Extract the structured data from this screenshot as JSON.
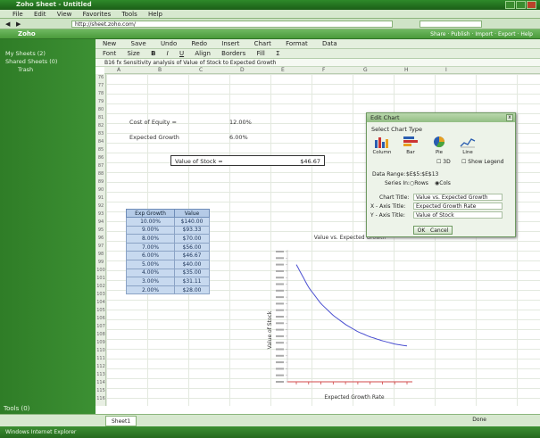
{
  "window": {
    "title": "Zoho Sheet - Untitled"
  },
  "menu": [
    "File",
    "Edit",
    "View",
    "Favorites",
    "Tools",
    "Help"
  ],
  "address": {
    "url": "http://sheet.zoho.com/"
  },
  "favbar": {
    "left": "Zoho",
    "right": "Share · Publish · Import · Export · Help"
  },
  "left_panel": {
    "items": [
      "My Sheets (2)",
      "Shared Sheets (0)",
      "Trash"
    ],
    "bottom": "Tools (0)"
  },
  "toolbar1": [
    "New",
    "Save",
    "Undo",
    "Redo",
    "Insert",
    "Chart",
    "Format",
    "Data"
  ],
  "toolbar2": [
    "Font",
    "Size",
    "B",
    "I",
    "U",
    "Align",
    "Borders",
    "Fill",
    "Σ"
  ],
  "formula_bar": "B16   fx  Sensitivity analysis of Value of Stock to Expected Growth",
  "columns": [
    "A",
    "B",
    "C",
    "D",
    "E",
    "F",
    "G",
    "H",
    "I"
  ],
  "rows": [
    "76",
    "77",
    "78",
    "79",
    "80",
    "81",
    "82",
    "83",
    "84",
    "85",
    "86",
    "87",
    "88",
    "89",
    "90",
    "91",
    "92",
    "93",
    "94",
    "95",
    "96",
    "97",
    "98",
    "99",
    "100",
    "101",
    "102",
    "103",
    "104",
    "105",
    "106",
    "107",
    "108",
    "109",
    "110",
    "111",
    "112",
    "113",
    "114",
    "115",
    "116"
  ],
  "inputs": [
    {
      "label": "Cost of Equity =",
      "value": "12.00%"
    },
    {
      "label": "Expected Growth",
      "value": "6.00%"
    }
  ],
  "result": {
    "label": "Value of Stock =",
    "value": "$46.67"
  },
  "sens_table": {
    "headers": [
      "Exp Growth",
      "Value"
    ],
    "rows": [
      [
        "10.00%",
        "$140.00"
      ],
      [
        "9.00%",
        "$93.33"
      ],
      [
        "8.00%",
        "$70.00"
      ],
      [
        "7.00%",
        "$56.00"
      ],
      [
        "6.00%",
        "$46.67"
      ],
      [
        "5.00%",
        "$40.00"
      ],
      [
        "4.00%",
        "$35.00"
      ],
      [
        "3.00%",
        "$31.11"
      ],
      [
        "2.00%",
        "$28.00"
      ]
    ]
  },
  "chart_data": {
    "type": "line",
    "title": "Value vs. Expected Growth",
    "xlabel": "Expected Growth Rate",
    "ylabel": "Value of Stock",
    "x": [
      1,
      2,
      3,
      4,
      5,
      6,
      7,
      8,
      9,
      10
    ],
    "series": [
      {
        "values": [
          1.8,
          1.45,
          1.2,
          1.02,
          0.88,
          0.77,
          0.69,
          0.63,
          0.58,
          0.55
        ]
      }
    ],
    "ylim": [
      0,
      2.0
    ],
    "color": "#4a4fd0",
    "axis_color": "#d04848"
  },
  "dialog": {
    "title": "Edit Chart",
    "close": "x",
    "select_type": "Select Chart Type",
    "chart_types": [
      "Column",
      "Bar",
      "Pie",
      "Line"
    ],
    "option_3d": "3D",
    "option_legend": "Show Legend",
    "data_range_label": "Data Range:",
    "data_range_value": "$E$5:$E$13",
    "series_in_label": "Series In:",
    "series_rows": "Rows",
    "series_cols": "Cols",
    "chart_title_label": "Chart Title:",
    "chart_title_value": "Value vs. Expected Growth",
    "xaxis_label": "X - Axis Title:",
    "xaxis_value": "Expected Growth Rate",
    "yaxis_label": "Y - Axis Title:",
    "yaxis_value": "Value of Stock",
    "ok": "OK",
    "cancel": "Cancel"
  },
  "status": {
    "tab": "Sheet1",
    "right": "Done"
  },
  "taskbar": {
    "text": "Windows Internet Explorer"
  }
}
